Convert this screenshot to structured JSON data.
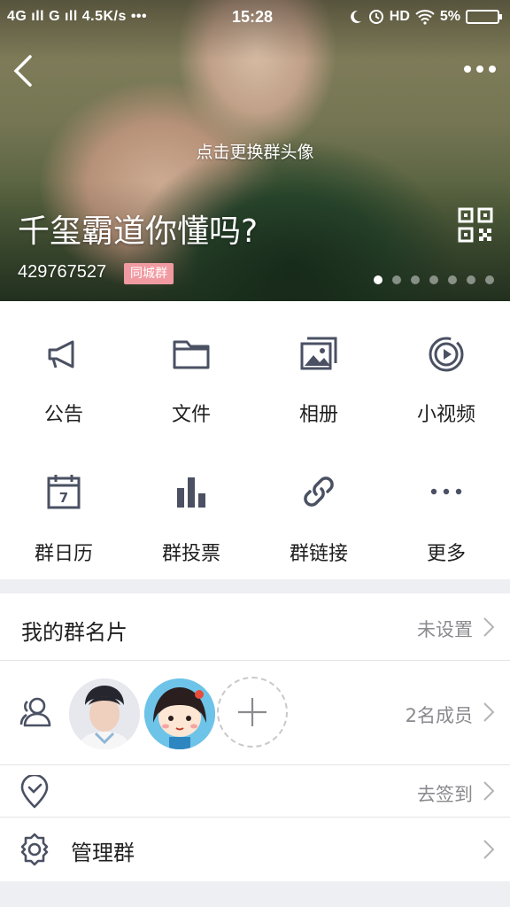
{
  "status_bar": {
    "left": "4G ıll  G ıll  4.5K/s •••",
    "time": "15:28",
    "right": "HD",
    "battery": "5%"
  },
  "header": {
    "change_avatar_hint": "点击更换群头像",
    "group_name": "千玺霸道你懂吗?",
    "group_id": "429767527",
    "badge": "同城群",
    "carousel_pages": 7,
    "carousel_active": 0
  },
  "grid": [
    {
      "label": "公告",
      "icon": "megaphone-icon"
    },
    {
      "label": "文件",
      "icon": "folder-icon"
    },
    {
      "label": "相册",
      "icon": "album-icon"
    },
    {
      "label": "小视频",
      "icon": "video-icon"
    },
    {
      "label": "群日历",
      "icon": "calendar-icon"
    },
    {
      "label": "群投票",
      "icon": "bar-chart-icon"
    },
    {
      "label": "群链接",
      "icon": "link-icon"
    },
    {
      "label": "更多",
      "icon": "more-dots-icon"
    }
  ],
  "my_card": {
    "title": "我的群名片",
    "value": "未设置"
  },
  "members": {
    "count_text": "2名成员"
  },
  "checkin": {
    "value": "去签到"
  },
  "manage": {
    "title": "管理群"
  },
  "colors": {
    "icon": "#4b5163",
    "badge": "#f19aa1",
    "text_secondary": "#8a8a8f"
  }
}
